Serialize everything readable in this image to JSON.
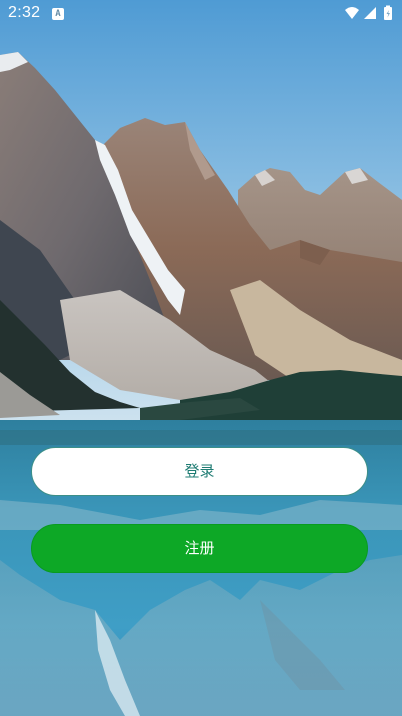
{
  "status_bar": {
    "time": "2:32",
    "app_icon_letter": "A",
    "wifi_icon": "wifi-icon",
    "signal_icon": "cellular-signal-icon",
    "battery_icon": "battery-charging-icon"
  },
  "background": {
    "description_icon": "mountain-lake-photo",
    "sky_top_color": "#5aa3d6",
    "water_color": "#2f8fb5"
  },
  "buttons": {
    "login_label": "登录",
    "register_label": "注册"
  },
  "colors": {
    "login_text": "#1f7c73",
    "register_bg": "#0da826"
  }
}
